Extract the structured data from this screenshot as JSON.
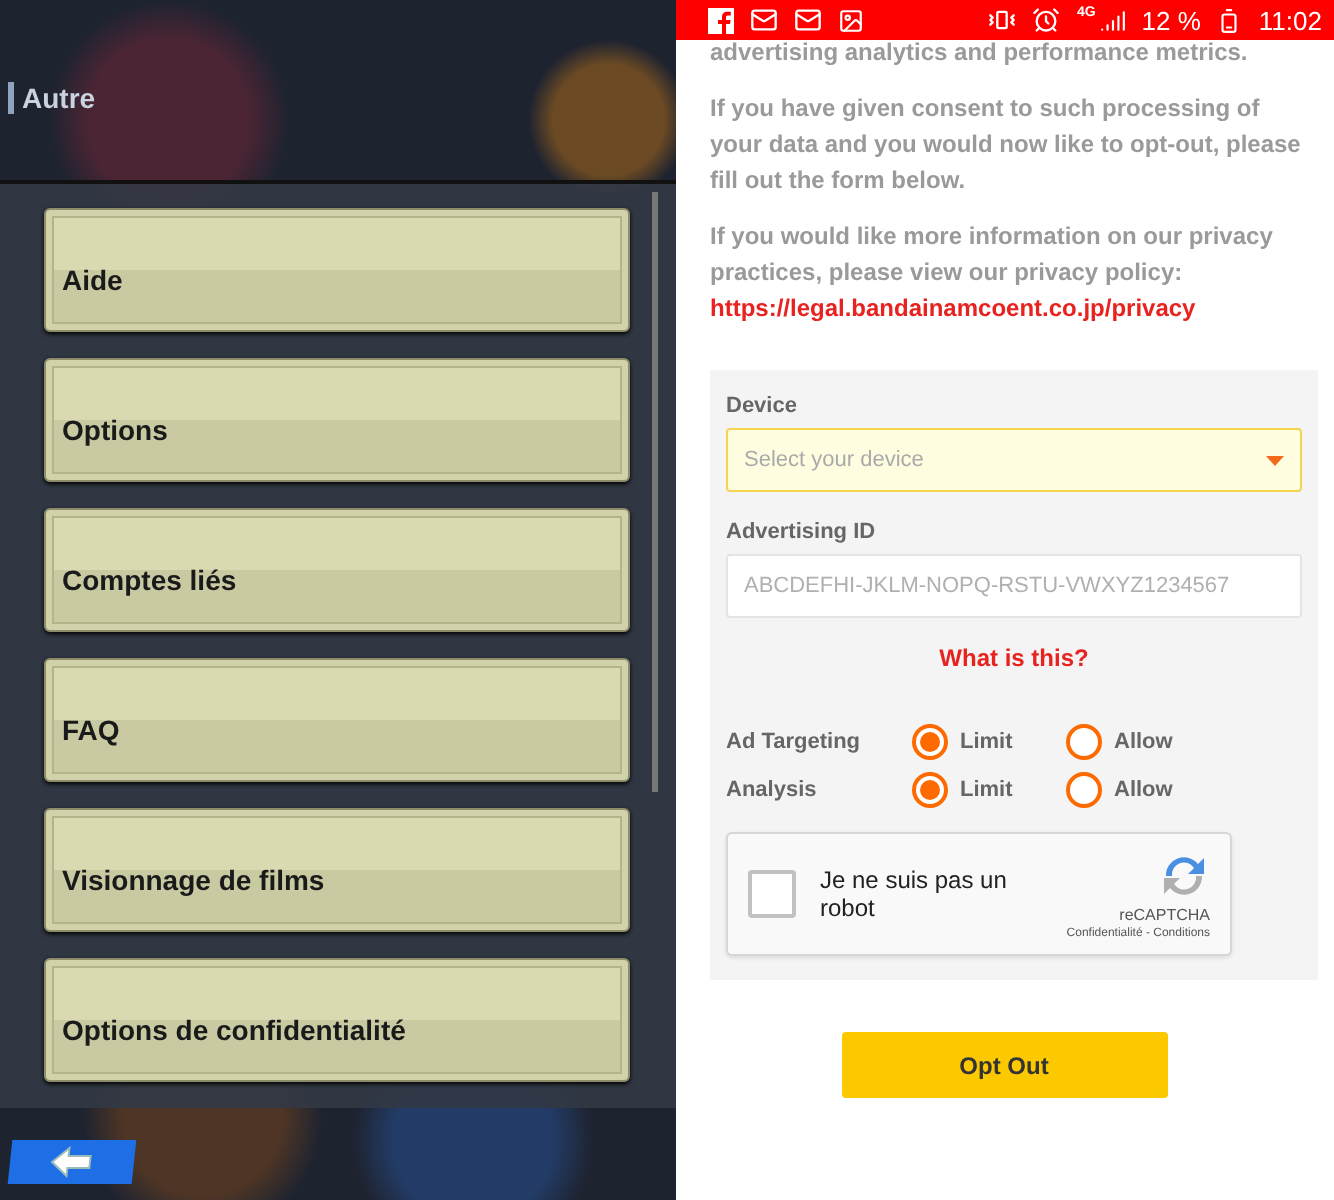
{
  "game_menu": {
    "section_title": "Autre",
    "items": [
      {
        "label": "Aide"
      },
      {
        "label": "Options"
      },
      {
        "label": "Comptes liés"
      },
      {
        "label": "FAQ"
      },
      {
        "label": "Visionnage de films"
      },
      {
        "label": "Options de confidentialité"
      }
    ]
  },
  "status_bar": {
    "network": "4G",
    "battery": "12 %",
    "time": "11:02"
  },
  "page": {
    "paragraphs": [
      "advertising analytics and performance metrics.",
      "If you have given consent to such processing of your data and you would now like to opt-out, please fill out the form below.",
      "If you would like more information on our privacy practices, please view our privacy policy:"
    ],
    "privacy_link": "https://legal.bandainamcoent.co.jp/privacy"
  },
  "form": {
    "device": {
      "label": "Device",
      "placeholder": "Select your device"
    },
    "advertising_id": {
      "label": "Advertising ID",
      "placeholder": "ABCDEFHI-JKLM-NOPQ-RSTU-VWXYZ1234567"
    },
    "help_link": "What is this?",
    "settings": [
      {
        "label": "Ad Targeting",
        "options": [
          {
            "label": "Limit",
            "selected": true
          },
          {
            "label": "Allow",
            "selected": false
          }
        ]
      },
      {
        "label": "Analysis",
        "options": [
          {
            "label": "Limit",
            "selected": true
          },
          {
            "label": "Allow",
            "selected": false
          }
        ]
      }
    ],
    "captcha": {
      "label": "Je ne suis pas un robot",
      "checked": false,
      "brand": "reCAPTCHA",
      "links": "Confidentialité - Conditions"
    }
  },
  "submit": "Opt Out"
}
